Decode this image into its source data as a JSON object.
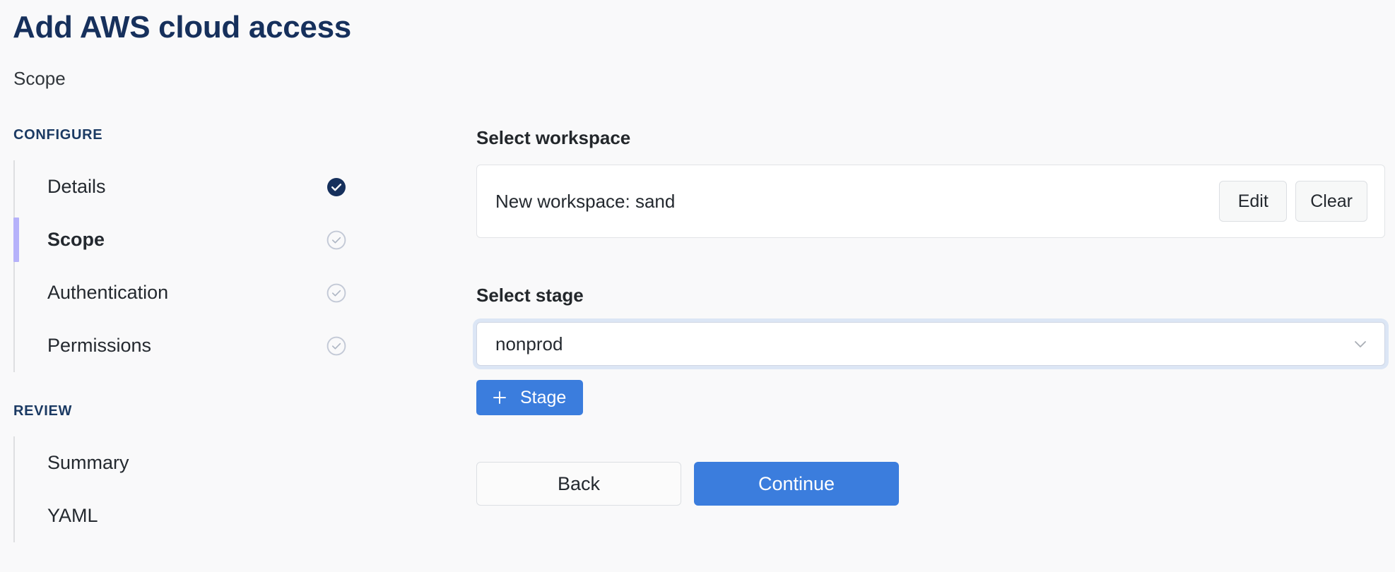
{
  "header": {
    "title": "Add AWS cloud access",
    "subtitle": "Scope"
  },
  "sidebar": {
    "groups": [
      {
        "header": "CONFIGURE",
        "items": [
          {
            "label": "Details",
            "state": "complete",
            "active": false
          },
          {
            "label": "Scope",
            "state": "pending",
            "active": true
          },
          {
            "label": "Authentication",
            "state": "pending",
            "active": false
          },
          {
            "label": "Permissions",
            "state": "pending",
            "active": false
          }
        ]
      },
      {
        "header": "REVIEW",
        "items": [
          {
            "label": "Summary",
            "state": "none",
            "active": false
          },
          {
            "label": "YAML",
            "state": "none",
            "active": false
          }
        ]
      }
    ]
  },
  "main": {
    "workspace": {
      "label": "Select workspace",
      "value": "New workspace: sand",
      "edit_label": "Edit",
      "clear_label": "Clear"
    },
    "stage": {
      "label": "Select stage",
      "value": "nonprod",
      "placeholder": "Select stage",
      "options": [
        "nonprod"
      ],
      "add_label": "Stage",
      "add_icon": "plus-icon",
      "chevron_icon": "chevron-down-icon"
    },
    "nav": {
      "back_label": "Back",
      "continue_label": "Continue"
    }
  },
  "colors": {
    "page_background": "#f9f9fa",
    "title_navy": "#16305c",
    "group_header_navy": "#1b3a63",
    "active_accent": "#b6b2fa",
    "step_track": "#dedfe1",
    "check_complete": "#16305c",
    "check_pending": "#c3c9d6",
    "primary_blue": "#3b7ddd",
    "focus_ring": "#dce6f5",
    "card_border": "#e2e4e7"
  }
}
